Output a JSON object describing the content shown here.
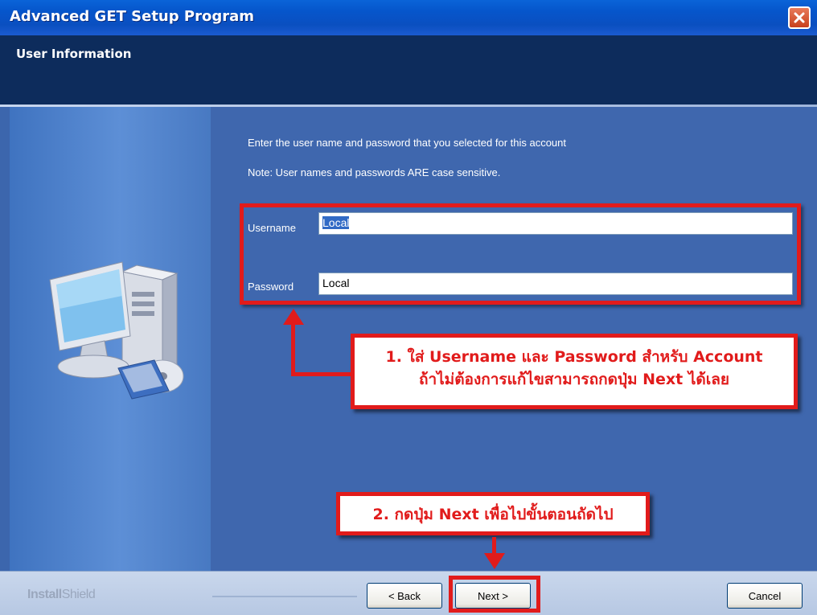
{
  "window": {
    "title": "Advanced GET Setup Program"
  },
  "header": {
    "title": "User Information"
  },
  "content": {
    "instruction": "Enter the user name and password that you selected for this account",
    "note": "Note:  User names and passwords ARE case sensitive.",
    "username_label": "Username",
    "username_value": "Local",
    "password_label": "Password",
    "password_value": "Local"
  },
  "annotations": {
    "callout1_line1": "1. ใส่ Username และ Password สำหรับ Account",
    "callout1_line2": "ถ้าไม่ต้องการแก้ไขสามารถกดปุ่ม Next ได้เลย",
    "callout2": "2. กดปุ่ม Next เพื่อไปขั้นตอนถัดไป"
  },
  "footer": {
    "brand_bold": "Install",
    "brand_light": "Shield",
    "back_label": "< Back",
    "next_label": "Next >",
    "cancel_label": "Cancel"
  },
  "colors": {
    "accent_red": "#e11b1b",
    "panel_blue": "#3f67ae",
    "header_navy": "#0d2c5c"
  },
  "icons": {
    "close": "close-icon",
    "computer": "computer-icon"
  }
}
